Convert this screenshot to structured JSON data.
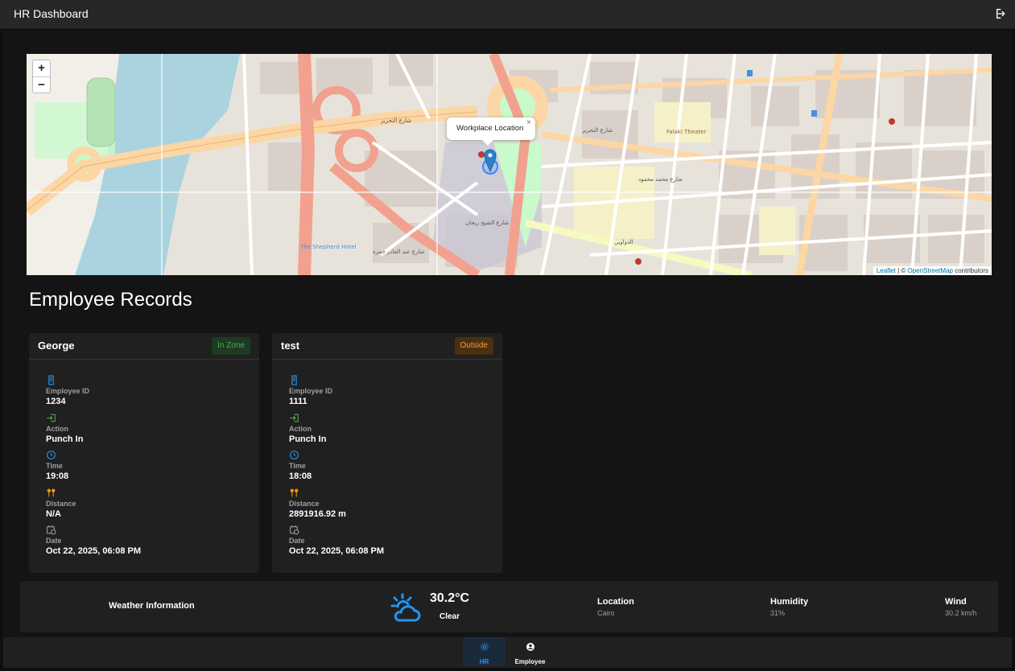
{
  "app": {
    "title": "HR Dashboard",
    "logout_icon": "logout-icon"
  },
  "map": {
    "zoom_in": "+",
    "zoom_out": "−",
    "popup": "Workplace Location",
    "popup_close": "×",
    "attribution": {
      "leaflet": "Leaflet",
      "sep": " | © ",
      "osm": "OpenStreetMap",
      "suffix": " contributors"
    },
    "labels": [
      "شارع التحرير",
      "شارع التحرير",
      "Falaki Theater",
      "The Shepherd Hotel",
      "شارع محمد محمود",
      "شارع الشيخ ريحان",
      "شارع عبد القادر حمزة",
      "الدواوين"
    ]
  },
  "records": {
    "title": "Employee Records",
    "cards": [
      {
        "name": "George",
        "status": "In Zone",
        "id_label": "Employee ID",
        "id": "1234",
        "action_label": "Action",
        "action": "Punch In",
        "time_label": "Time",
        "time": "19:08",
        "distance_label": "Distance",
        "distance": "N/A",
        "date_label": "Date",
        "date": "Oct 22, 2025, 06:08 PM"
      },
      {
        "name": "test",
        "status": "Outside",
        "id_label": "Employee ID",
        "id": "1111",
        "action_label": "Action",
        "action": "Punch In",
        "time_label": "Time",
        "time": "18:08",
        "distance_label": "Distance",
        "distance": "2891916.92 m",
        "date_label": "Date",
        "date": "Oct 22, 2025, 06:08 PM"
      }
    ]
  },
  "weather": {
    "title": "Weather Information",
    "icon": "partly-cloudy-icon",
    "temp": "30.2°C",
    "condition": "Clear",
    "location_label": "Location",
    "location": "Cairo",
    "humidity_label": "Humidity",
    "humidity": "31%",
    "wind_label": "Wind",
    "wind": "30.2 km/h"
  },
  "nav": {
    "hr": "HR",
    "employee": "Employee"
  },
  "colors": {
    "accent": "#2196f3",
    "in_zone": "#4caf50",
    "outside": "#f0a13a",
    "action_green": "#4caf50",
    "distance_orange": "#ff9800"
  }
}
